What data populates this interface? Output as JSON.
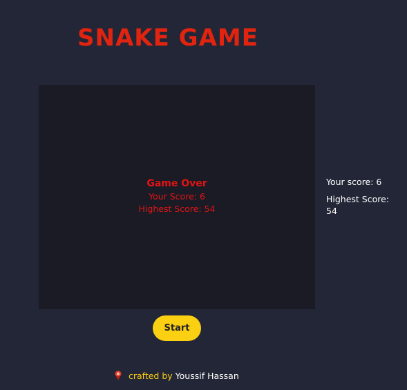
{
  "header": {
    "logo_text": "SNAKE GAME"
  },
  "board": {
    "game_over_title": "Game Over",
    "your_score_line": "Your Score: 6",
    "highest_score_line": "Highest Score: 54"
  },
  "sidebar": {
    "your_score_text": "Your score: 6",
    "highest_score_label": "Highest Score:",
    "highest_score_value": "54"
  },
  "controls": {
    "start_label": "Start"
  },
  "footer": {
    "crafted_label": "crafted by",
    "author": "Youssif Hassan"
  },
  "colors": {
    "background": "#222636",
    "board": "#1b1b25",
    "logo": "#e0240f",
    "game_over_text": "#e01414",
    "button": "#fbcf12",
    "button_text": "#1f1f28",
    "sidebar_text": "#ffffff"
  },
  "icons": {
    "footer_icon": "map-pin-icon"
  }
}
